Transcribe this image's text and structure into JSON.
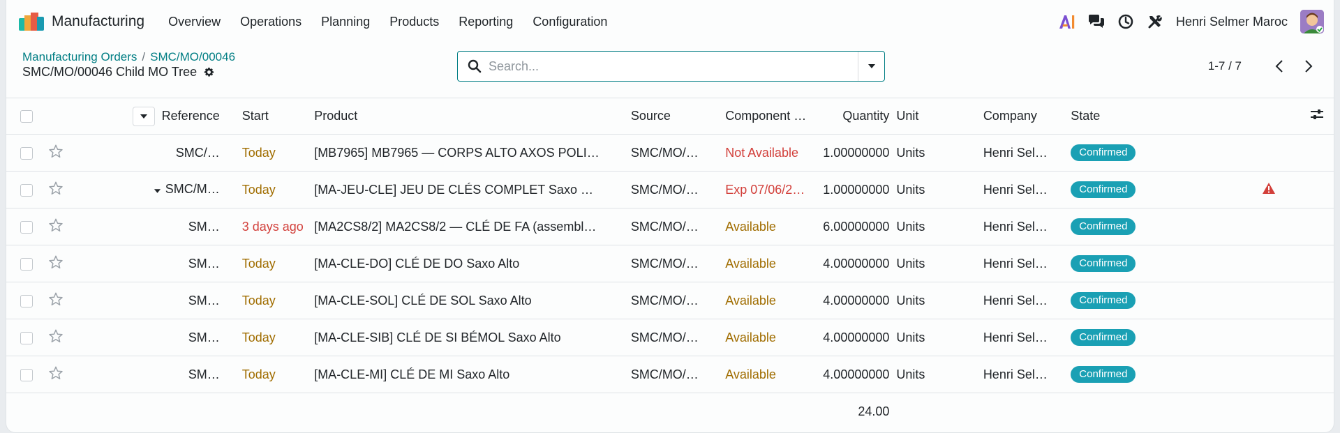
{
  "navbar": {
    "app_name": "Manufacturing",
    "menu": [
      "Overview",
      "Operations",
      "Planning",
      "Products",
      "Reporting",
      "Configuration"
    ],
    "user_name": "Henri Selmer Maroc",
    "icons": [
      "ai-icon",
      "chat-icon",
      "clock-icon",
      "tools-icon"
    ]
  },
  "breadcrumb": {
    "parent": "Manufacturing Orders",
    "record": "SMC/MO/00046",
    "separator": "/"
  },
  "title": "SMC/MO/00046 Child MO Tree",
  "search": {
    "placeholder": "Search..."
  },
  "pager": {
    "value": "1-7 / 7"
  },
  "table": {
    "columns": [
      "Reference",
      "Start",
      "Product",
      "Source",
      "Component …",
      "Quantity",
      "Unit",
      "Company",
      "State"
    ],
    "rows": [
      {
        "reference": "SMC/…",
        "expand": false,
        "start": "Today",
        "start_overdue": false,
        "product": "[MB7965] MB7965 — CORPS ALTO AXOS POLI…",
        "source": "SMC/MO/…",
        "component": "Not Available",
        "component_status": "danger",
        "quantity": "1.00000000",
        "unit": "Units",
        "company": "Henri Sel…",
        "state": "Confirmed",
        "alert": false
      },
      {
        "reference": "SMC/M…",
        "expand": true,
        "start": "Today",
        "start_overdue": false,
        "product": "[MA-JEU-CLE] JEU DE CLÉS COMPLET Saxo …",
        "source": "SMC/MO/…",
        "component": "Exp 07/06/2…",
        "component_status": "danger",
        "quantity": "1.00000000",
        "unit": "Units",
        "company": "Henri Sel…",
        "state": "Confirmed",
        "alert": true
      },
      {
        "reference": "SM…",
        "expand": false,
        "start": "3 days ago",
        "start_overdue": true,
        "product": "[MA2CS8/2] MA2CS8/2 — CLÉ DE FA (assembl…",
        "source": "SMC/MO/…",
        "component": "Available",
        "component_status": "warn",
        "quantity": "6.00000000",
        "unit": "Units",
        "company": "Henri Sel…",
        "state": "Confirmed",
        "alert": false
      },
      {
        "reference": "SM…",
        "expand": false,
        "start": "Today",
        "start_overdue": false,
        "product": "[MA-CLE-DO] CLÉ DE DO Saxo Alto",
        "source": "SMC/MO/…",
        "component": "Available",
        "component_status": "warn",
        "quantity": "4.00000000",
        "unit": "Units",
        "company": "Henri Sel…",
        "state": "Confirmed",
        "alert": false
      },
      {
        "reference": "SM…",
        "expand": false,
        "start": "Today",
        "start_overdue": false,
        "product": "[MA-CLE-SOL] CLÉ DE SOL Saxo Alto",
        "source": "SMC/MO/…",
        "component": "Available",
        "component_status": "warn",
        "quantity": "4.00000000",
        "unit": "Units",
        "company": "Henri Sel…",
        "state": "Confirmed",
        "alert": false
      },
      {
        "reference": "SM…",
        "expand": false,
        "start": "Today",
        "start_overdue": false,
        "product": "[MA-CLE-SIB] CLÉ DE SI BÉMOL Saxo Alto",
        "source": "SMC/MO/…",
        "component": "Available",
        "component_status": "warn",
        "quantity": "4.00000000",
        "unit": "Units",
        "company": "Henri Sel…",
        "state": "Confirmed",
        "alert": false
      },
      {
        "reference": "SM…",
        "expand": false,
        "start": "Today",
        "start_overdue": false,
        "product": "[MA-CLE-MI] CLÉ DE MI Saxo Alto",
        "source": "SMC/MO/…",
        "component": "Available",
        "component_status": "warn",
        "quantity": "4.00000000",
        "unit": "Units",
        "company": "Henri Sel…",
        "state": "Confirmed",
        "alert": false
      }
    ],
    "total_quantity": "24.00"
  },
  "colors": {
    "accent": "#017e84",
    "badge": "#1aa0b4",
    "danger": "#d23f3a",
    "warning": "#a06d00"
  }
}
